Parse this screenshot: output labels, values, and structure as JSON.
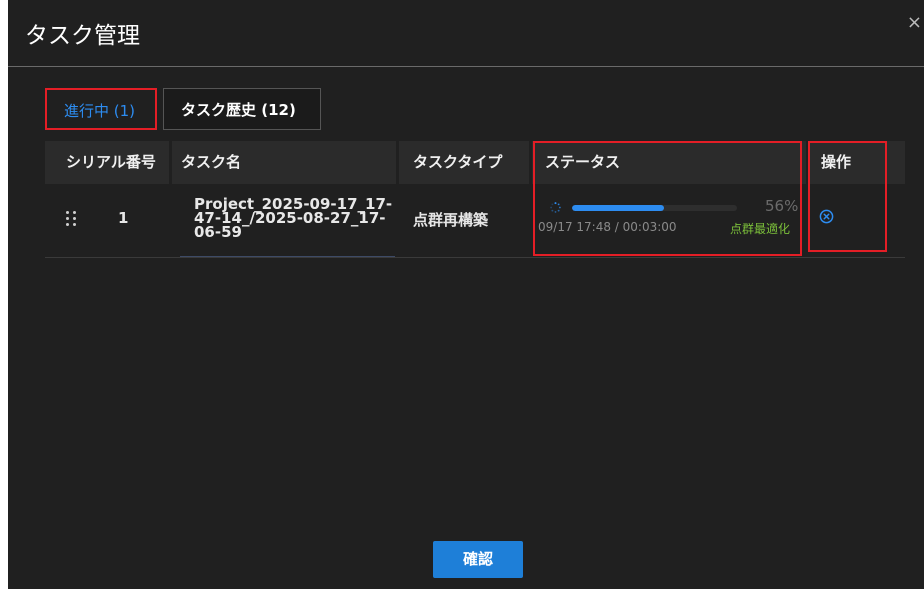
{
  "dialog": {
    "title": "タスク管理",
    "close_label": "×"
  },
  "tabs": [
    {
      "label": "進行中 (1)",
      "active": true
    },
    {
      "label": "タスク歴史 (12)",
      "active": false
    }
  ],
  "table": {
    "headers": {
      "serial": "シリアル番号",
      "name": "タスク名",
      "type": "タスクタイプ",
      "status": "ステータス",
      "actions": "操作"
    },
    "rows": [
      {
        "serial": "1",
        "name_line1": "Project_2025-09-17_17-",
        "name_line2": "47-14_/2025-08-27_17-",
        "name_line3": "06-59",
        "type": "点群再構築",
        "progress_percent": 56,
        "progress_label": "56%",
        "time": "09/17 17:48 / 00:03:00",
        "stage": "点群最適化"
      }
    ]
  },
  "footer": {
    "confirm_label": "確認"
  },
  "colors": {
    "accent": "#2d8cf0",
    "stage_green": "#7bbf3a",
    "highlight_red": "#e41e26",
    "dialog_bg": "#202020"
  },
  "icons": {
    "drag": "drag-handle-icon",
    "spinner": "spinner-icon",
    "cancel": "cancel-circle-icon",
    "close": "close-icon"
  }
}
